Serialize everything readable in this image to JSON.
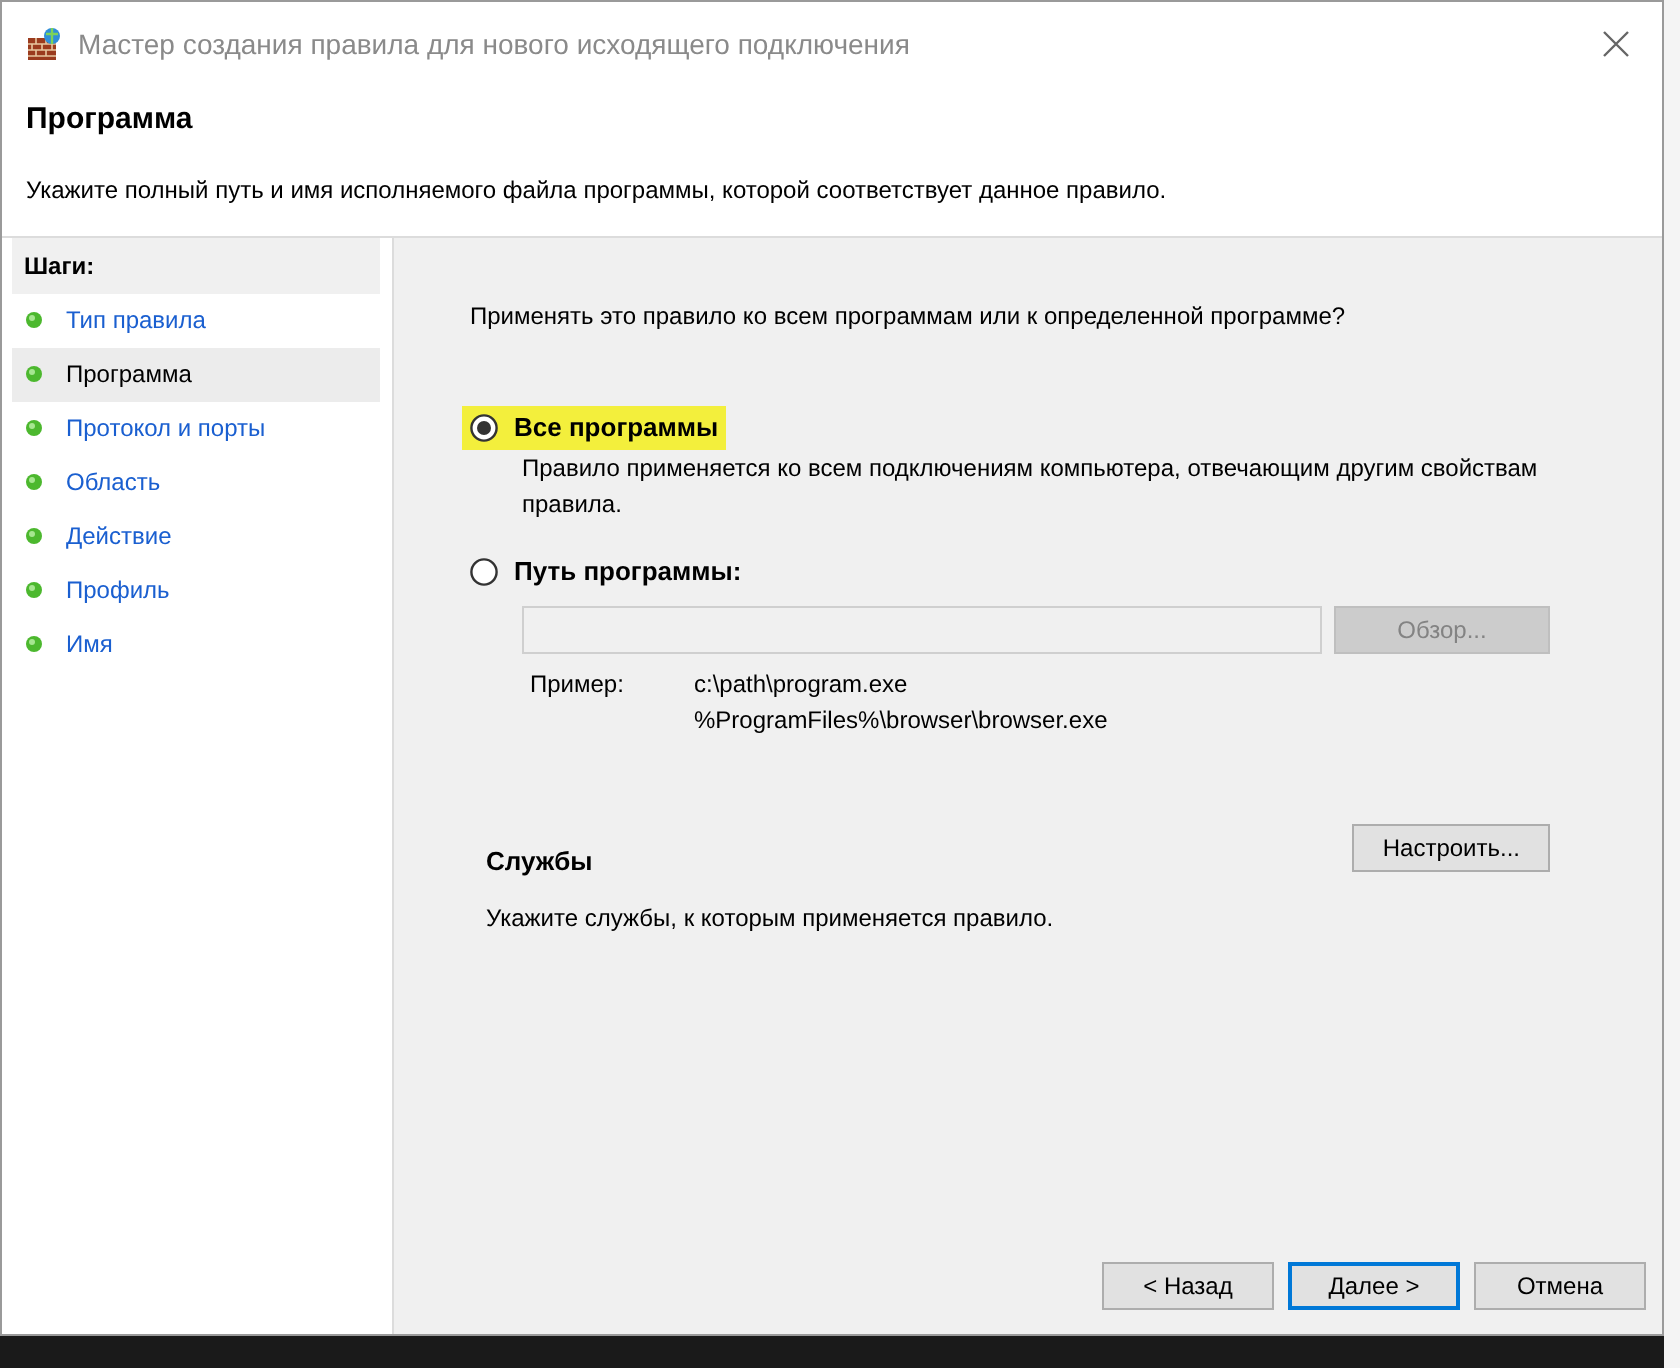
{
  "window": {
    "title": "Мастер создания правила для нового исходящего подключения"
  },
  "header": {
    "title": "Программа",
    "description": "Укажите полный путь и имя исполняемого файла программы, которой соответствует данное правило."
  },
  "steps": {
    "heading": "Шаги:",
    "items": [
      {
        "label": "Тип правила",
        "selected": false
      },
      {
        "label": "Программа",
        "selected": true
      },
      {
        "label": "Протокол и порты",
        "selected": false
      },
      {
        "label": "Область",
        "selected": false
      },
      {
        "label": "Действие",
        "selected": false
      },
      {
        "label": "Профиль",
        "selected": false
      },
      {
        "label": "Имя",
        "selected": false
      }
    ]
  },
  "question": "Применять это правило ко всем программам или к определенной программе?",
  "options": [
    {
      "label": "Все программы",
      "selected": true,
      "highlighted": true,
      "description": "Правило применяется ко всем подключениям компьютера, отвечающим другим свойствам правила."
    },
    {
      "label": "Путь программы:",
      "selected": false,
      "highlighted": false
    }
  ],
  "path_field": {
    "disabled": true
  },
  "browse_button": {
    "label": "Обзор...",
    "disabled": true
  },
  "example": {
    "label": "Пример:",
    "lines": [
      "c:\\path\\program.exe",
      "%ProgramFiles%\\browser\\browser.exe"
    ]
  },
  "services": {
    "title": "Службы",
    "description": "Укажите службы, к которым применяется правило.",
    "button": "Настроить..."
  },
  "buttons": [
    {
      "label": "< Назад",
      "default": false
    },
    {
      "label": "Далее >",
      "default": true
    },
    {
      "label": "Отмена",
      "default": false
    }
  ]
}
